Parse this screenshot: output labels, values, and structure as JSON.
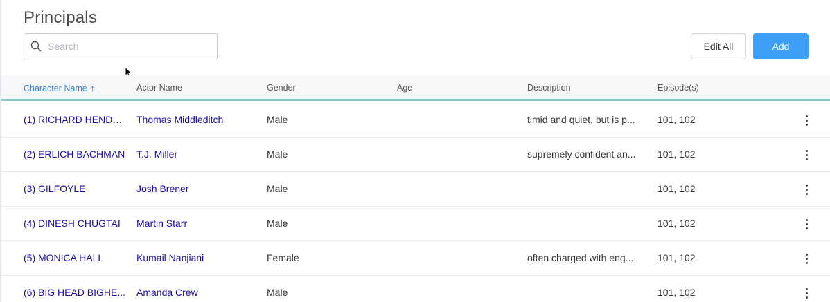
{
  "page": {
    "title": "Principals"
  },
  "search": {
    "placeholder": "Search",
    "value": ""
  },
  "toolbar": {
    "edit_all_label": "Edit All",
    "add_label": "Add"
  },
  "colors": {
    "accent": "#3d9ff5",
    "header_border": "#7fcdc6",
    "link": "#1a0dab",
    "sorted_header": "#2f7fd0"
  },
  "table": {
    "columns": [
      {
        "label": "Character Name",
        "sorted": "ascending"
      },
      {
        "label": "Actor Name"
      },
      {
        "label": "Gender"
      },
      {
        "label": "Age"
      },
      {
        "label": "Description"
      },
      {
        "label": "Episode(s)"
      }
    ],
    "rows": [
      {
        "character": "(1) RICHARD HENDR...",
        "actor": "Thomas Middleditch",
        "gender": "Male",
        "age": "",
        "description": "timid and quiet, but is p...",
        "episodes": "101, 102"
      },
      {
        "character": "(2) ERLICH BACHMAN",
        "actor": "T.J. Miller",
        "gender": "Male",
        "age": "",
        "description": "supremely confident an...",
        "episodes": "101, 102"
      },
      {
        "character": "(3) GILFOYLE",
        "actor": "Josh Brener",
        "gender": "Male",
        "age": "",
        "description": "",
        "episodes": "101, 102"
      },
      {
        "character": "(4) DINESH CHUGTAI",
        "actor": "Martin Starr",
        "gender": "Male",
        "age": "",
        "description": "",
        "episodes": "101, 102"
      },
      {
        "character": "(5) MONICA HALL",
        "actor": "Kumail Nanjiani",
        "gender": "Female",
        "age": "",
        "description": "often charged with eng...",
        "episodes": "101, 102"
      },
      {
        "character": "(6) BIG HEAD BIGHE...",
        "actor": "Amanda Crew",
        "gender": "Male",
        "age": "",
        "description": "",
        "episodes": "101, 102"
      }
    ]
  }
}
